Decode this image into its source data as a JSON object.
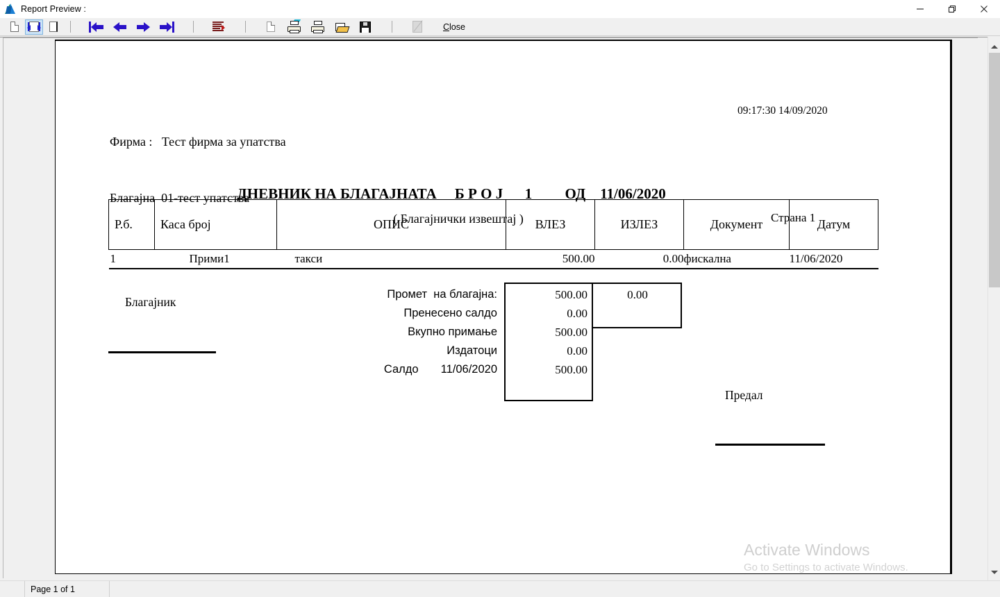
{
  "window": {
    "title": "Report Preview :",
    "icon": "app-logo-icon",
    "minimize_label": "—",
    "maximize_label": "❐",
    "close_label": "✕"
  },
  "toolbar": {
    "buttons": [
      {
        "name": "single-page-view",
        "label": "Single Page"
      },
      {
        "name": "fit-width-view",
        "label": "Fit Width"
      },
      {
        "name": "whole-page-view",
        "label": "Whole Page"
      },
      {
        "name": "first-page",
        "label": "First Page"
      },
      {
        "name": "previous-page",
        "label": "Previous Page"
      },
      {
        "name": "next-page",
        "label": "Next Page"
      },
      {
        "name": "last-page",
        "label": "Last Page"
      },
      {
        "name": "goto-page",
        "label": "Go To Page"
      },
      {
        "name": "copy-page",
        "label": "Copy"
      },
      {
        "name": "print-setup",
        "label": "Print Setup"
      },
      {
        "name": "print",
        "label": "Print"
      },
      {
        "name": "open-file",
        "label": "Open"
      },
      {
        "name": "save-file",
        "label": "Save"
      },
      {
        "name": "export",
        "label": "Export"
      }
    ],
    "close_label_underlined": "C",
    "close_label_rest": "lose"
  },
  "report": {
    "firm_line1": "Фирма :   Тест фирма за упатства",
    "firm_line2": "Благајна  01-тест упатства",
    "timestamp": "09:17:30 14/09/2020",
    "title": "ДНЕВНИК НА БЛАГАЈНАТА     Б Р О Ј      1         ОД    11/06/2020",
    "subtitle": "( Благајнички извештај )",
    "page_number": "Страна 1",
    "table": {
      "headers": [
        "Р.б.",
        "Каса број",
        "ОПИС",
        "ВЛЕЗ",
        "ИЗЛЕЗ",
        "Документ",
        "Датум"
      ],
      "rows": [
        {
          "rb": "1",
          "kasa": "Прими1",
          "opis": "такси",
          "vlez": "500.00",
          "izlez": "0.00",
          "dokument": "фискална",
          "datum": "11/06/2020"
        }
      ]
    },
    "summary": {
      "cashier_label": "Благајник",
      "handover_label": "Предал",
      "rows": [
        {
          "label": "Промет  на благајна:",
          "value": "500.00"
        },
        {
          "label": "Пренесено салдо",
          "value": "0.00"
        },
        {
          "label": "Вкупно примање",
          "value": "500.00"
        },
        {
          "label": "Издатоци",
          "value": "0.00"
        },
        {
          "label": "Салдо       11/06/2020",
          "value": "500.00"
        }
      ],
      "outgoing_value": "0.00"
    }
  },
  "watermark": {
    "title": "Activate Windows",
    "subtitle": "Go to Settings to activate Windows."
  },
  "statusbar": {
    "page_info": "Page 1 of 1"
  },
  "colors": {
    "toolbar_bg": "#f0f0f0",
    "checked_btn": "#cce4f7",
    "arrow_blue": "#2a12c8",
    "watermark": "#d0d0d0",
    "page_bg": "#ffffff"
  }
}
